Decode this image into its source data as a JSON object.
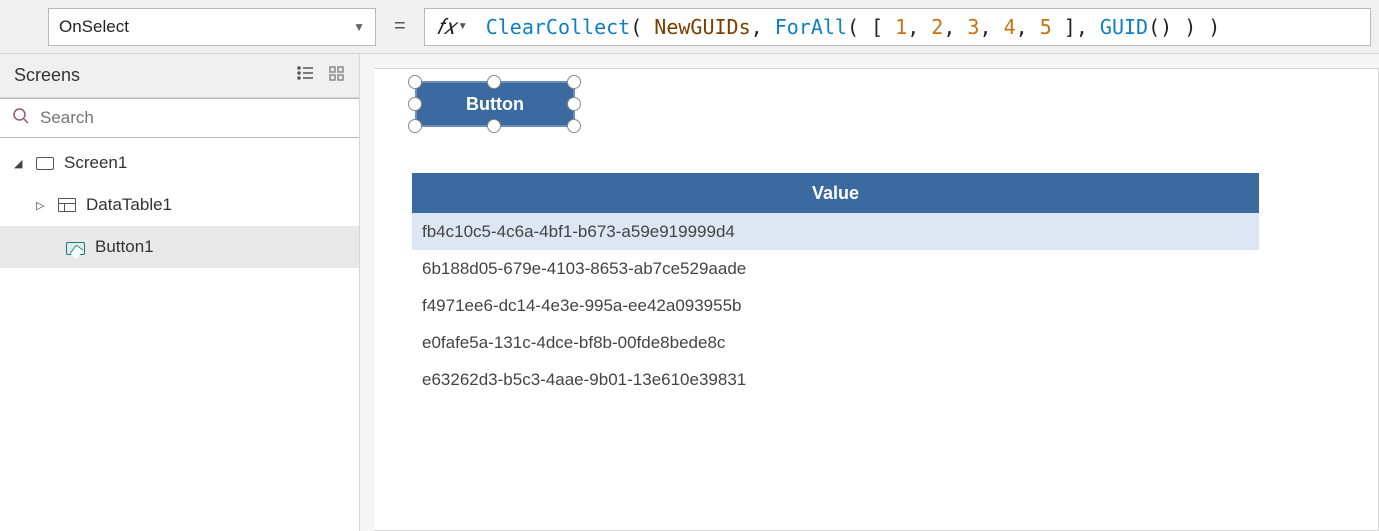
{
  "formulaBar": {
    "property": "OnSelect",
    "tokens": [
      {
        "t": "fn",
        "v": "ClearCollect"
      },
      {
        "t": "txt",
        "v": "( "
      },
      {
        "t": "var",
        "v": "NewGUIDs"
      },
      {
        "t": "txt",
        "v": ", "
      },
      {
        "t": "fn",
        "v": "ForAll"
      },
      {
        "t": "txt",
        "v": "( [ "
      },
      {
        "t": "num",
        "v": "1"
      },
      {
        "t": "txt",
        "v": ", "
      },
      {
        "t": "num",
        "v": "2"
      },
      {
        "t": "txt",
        "v": ", "
      },
      {
        "t": "num",
        "v": "3"
      },
      {
        "t": "txt",
        "v": ", "
      },
      {
        "t": "num",
        "v": "4"
      },
      {
        "t": "txt",
        "v": ", "
      },
      {
        "t": "num",
        "v": "5"
      },
      {
        "t": "txt",
        "v": " ], "
      },
      {
        "t": "fn",
        "v": "GUID"
      },
      {
        "t": "txt",
        "v": "() ) )"
      }
    ]
  },
  "panel": {
    "title": "Screens",
    "searchPlaceholder": "Search"
  },
  "tree": {
    "screen": "Screen1",
    "datatable": "DataTable1",
    "button": "Button1"
  },
  "canvas": {
    "buttonLabel": "Button",
    "table": {
      "header": "Value",
      "rows": [
        "fb4c10c5-4c6a-4bf1-b673-a59e919999d4",
        "6b188d05-679e-4103-8653-ab7ce529aade",
        "f4971ee6-dc14-4e3e-995a-ee42a093955b",
        "e0fafe5a-131c-4dce-bf8b-00fde8bede8c",
        "e63262d3-b5c3-4aae-9b01-13e610e39831"
      ]
    }
  }
}
